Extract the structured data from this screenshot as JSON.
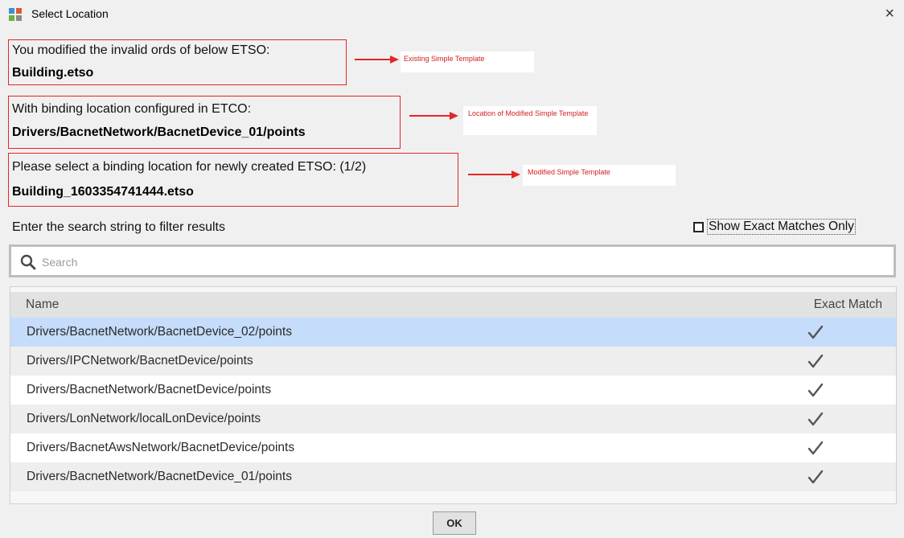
{
  "window": {
    "title": "Select Location",
    "close_glyph": "×"
  },
  "info_boxes": [
    {
      "text": "You modified the invalid ords of below ETSO:",
      "value": "Building.etso",
      "annotation": "Existing Simple Template"
    },
    {
      "text": "With binding location configured in ETCO:",
      "value": "Drivers/BacnetNetwork/BacnetDevice_01/points",
      "annotation": "Location of Modified Simple Template"
    },
    {
      "text": "Please select a binding location for newly created ETSO: (1/2)",
      "value": "Building_1603354741444.etso",
      "annotation": "Modified Simple Template"
    }
  ],
  "filter": {
    "label": "Enter the search string to filter results",
    "exact_label": "Show Exact Matches Only",
    "exact_checked": false
  },
  "search": {
    "placeholder": "Search",
    "value": ""
  },
  "table": {
    "columns": [
      "Name",
      "Exact Match"
    ],
    "rows": [
      {
        "name": "Drivers/BacnetNetwork/BacnetDevice_02/points",
        "exact": true,
        "selected": true
      },
      {
        "name": "Drivers/IPCNetwork/BacnetDevice/points",
        "exact": true,
        "selected": false
      },
      {
        "name": "Drivers/BacnetNetwork/BacnetDevice/points",
        "exact": true,
        "selected": false
      },
      {
        "name": "Drivers/LonNetwork/localLonDevice/points",
        "exact": true,
        "selected": false
      },
      {
        "name": "Drivers/BacnetAwsNetwork/BacnetDevice/points",
        "exact": true,
        "selected": false
      },
      {
        "name": "Drivers/BacnetNetwork/BacnetDevice_01/points",
        "exact": true,
        "selected": false
      }
    ]
  },
  "ok_label": "OK",
  "colors": {
    "selection": "#c5dcfb",
    "row_alt": "#eeeeee",
    "row": "#ffffff",
    "annotation_red": "#e32626"
  }
}
